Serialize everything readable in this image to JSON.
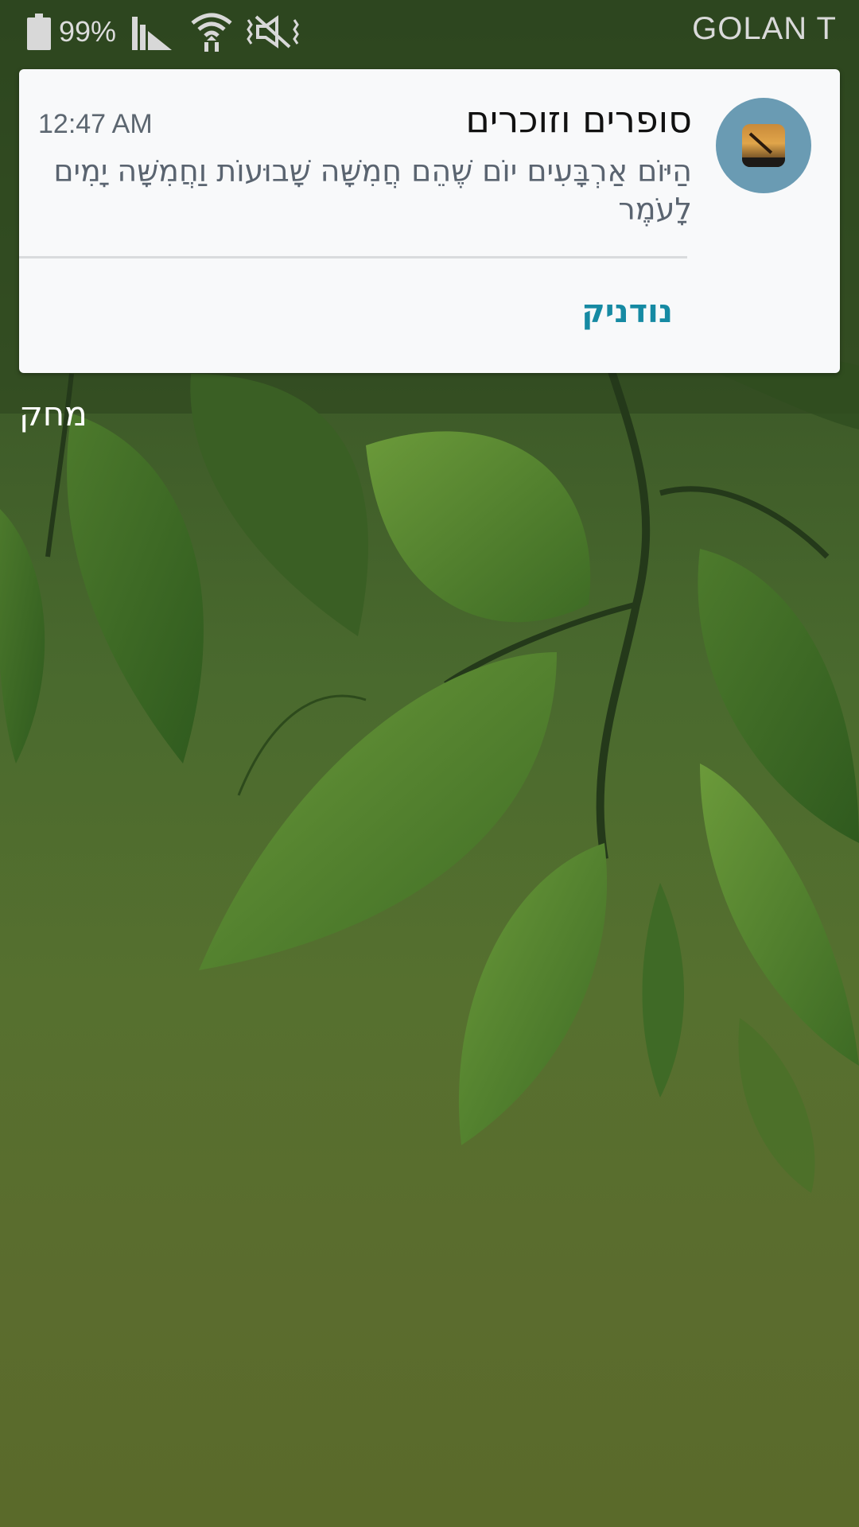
{
  "status_bar": {
    "battery_percent": "99%",
    "carrier": "GOLAN T",
    "icons": [
      "battery-icon",
      "signal-icon",
      "wifi-icon",
      "mute-icon"
    ]
  },
  "notification": {
    "app_icon": "omer-count-app-icon",
    "title": "סופרים וזוכרים",
    "time": "12:47 AM",
    "body": "הַיּוֹם אַרְבָּעִים יוֹם שֶׁהֵם חֲמִשָּׁה שָׁבוּעוֹת וַחֲמִשָּׁה יָמִים לָעֹמֶר",
    "action_label": "נודניק",
    "action_color": "#168aa3",
    "app_icon_bg": "#6a9bb3"
  },
  "clear_label": "מחק"
}
